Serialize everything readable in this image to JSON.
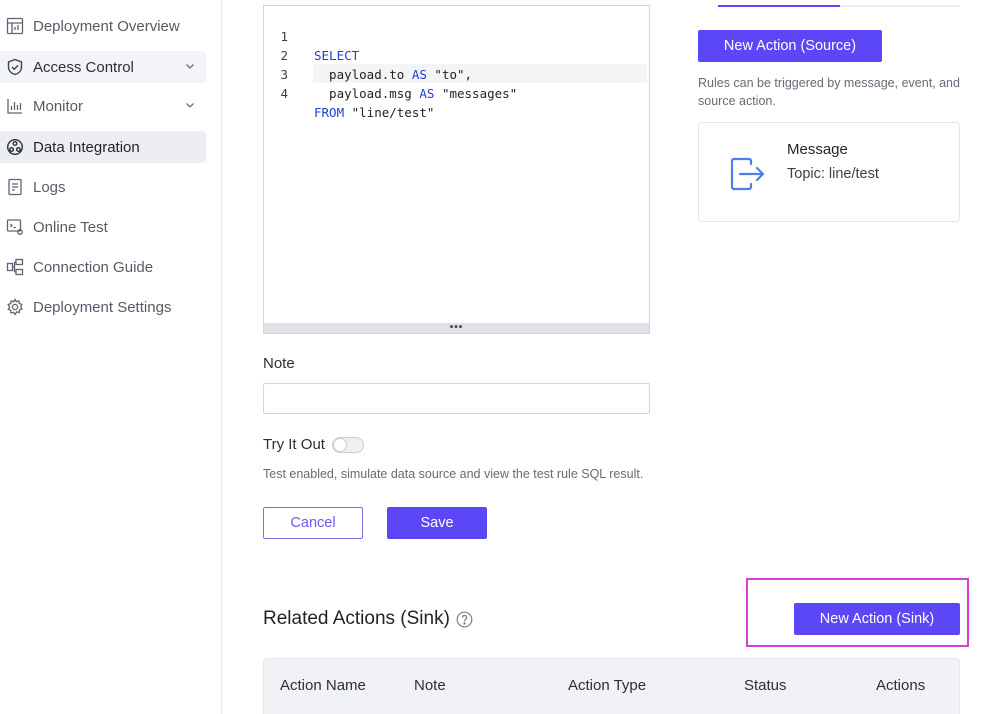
{
  "sidebar": {
    "items": [
      {
        "label": "Deployment Overview",
        "icon": "dashboard-icon"
      },
      {
        "label": "Access Control",
        "icon": "shield-check-icon",
        "expandable": true
      },
      {
        "label": "Monitor",
        "icon": "bar-chart-icon",
        "expandable": true
      },
      {
        "label": "Data Integration",
        "icon": "integration-icon",
        "active": true
      },
      {
        "label": "Logs",
        "icon": "log-file-icon"
      },
      {
        "label": "Online Test",
        "icon": "online-test-icon"
      },
      {
        "label": "Connection Guide",
        "icon": "connection-guide-icon"
      },
      {
        "label": "Deployment Settings",
        "icon": "gear-icon"
      }
    ]
  },
  "editor": {
    "line_numbers": [
      "1",
      "2",
      "3",
      "4"
    ],
    "lines": [
      {
        "kw": "SELECT",
        "rest": ""
      },
      {
        "pre": "  payload.to ",
        "kw": "AS",
        "str": " \"to\"",
        "post": ","
      },
      {
        "pre": "  payload.msg ",
        "kw": "AS",
        "str": " \"messages\"",
        "post": ""
      },
      {
        "kw": "FROM",
        "str": " \"line/test\"",
        "post": ""
      }
    ],
    "resize_handle": "•••"
  },
  "form": {
    "note_label": "Note",
    "note_value": "",
    "try_label": "Try It Out",
    "try_enabled": false,
    "try_hint": "Test enabled, simulate data source and view the test rule SQL result.",
    "cancel_label": "Cancel",
    "save_label": "Save"
  },
  "source_panel": {
    "new_action_label": "New Action (Source)",
    "hint": "Rules can be triggered by message, event, and source action.",
    "card_title": "Message",
    "card_topic": "Topic: line/test"
  },
  "related": {
    "title": "Related Actions (Sink)",
    "new_action_label": "New Action (Sink)",
    "columns": [
      "Action Name",
      "Note",
      "Action Type",
      "Status",
      "Actions"
    ]
  },
  "colors": {
    "accent": "#5b47f5",
    "highlight": "#d63fd6"
  }
}
